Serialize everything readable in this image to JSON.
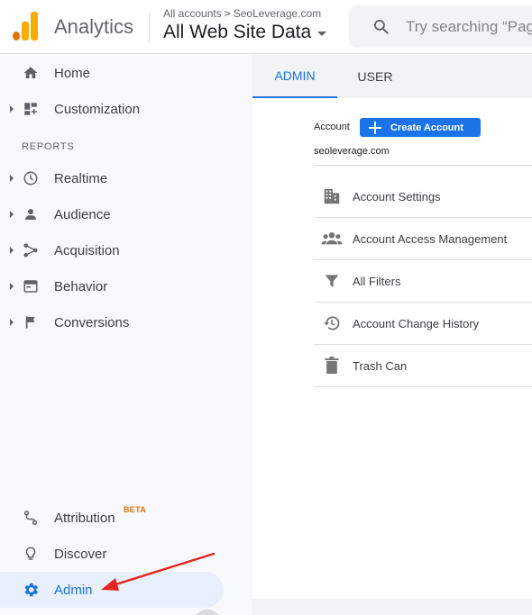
{
  "header": {
    "app_name": "Analytics",
    "breadcrumb": {
      "root": "All accounts",
      "separator": ">",
      "account": "SeoLeverage.com"
    },
    "view_name": "All Web Site Data",
    "search_placeholder": "Try searching “Pag"
  },
  "sidebar": {
    "items_top": [
      {
        "label": "Home",
        "icon": "home-icon"
      },
      {
        "label": "Customization",
        "icon": "dashboard-icon"
      }
    ],
    "section_label": "REPORTS",
    "reports": [
      {
        "label": "Realtime",
        "icon": "clock-icon"
      },
      {
        "label": "Audience",
        "icon": "person-icon"
      },
      {
        "label": "Acquisition",
        "icon": "acquisition-icon"
      },
      {
        "label": "Behavior",
        "icon": "behavior-icon"
      },
      {
        "label": "Conversions",
        "icon": "flag-icon"
      }
    ],
    "items_bottom": [
      {
        "label": "Attribution",
        "badge": "BETA",
        "icon": "attribution-icon"
      },
      {
        "label": "Discover",
        "icon": "lightbulb-icon"
      },
      {
        "label": "Admin",
        "icon": "gear-icon",
        "active": true
      }
    ]
  },
  "tabs": [
    {
      "label": "ADMIN",
      "selected": true
    },
    {
      "label": "USER",
      "selected": false
    }
  ],
  "account_column": {
    "label": "Account",
    "create_button": "Create Account",
    "selected_account": "seoleverage.com",
    "menu": [
      {
        "label": "Account Settings",
        "icon": "building-icon"
      },
      {
        "label": "Account Access Management",
        "icon": "people-icon"
      },
      {
        "label": "All Filters",
        "icon": "filter-icon"
      },
      {
        "label": "Account Change History",
        "icon": "history-icon"
      },
      {
        "label": "Trash Can",
        "icon": "trash-icon"
      }
    ]
  },
  "colors": {
    "accent": "#1a73e8",
    "logo_orange": "#f9ab00",
    "logo_dark_orange": "#e37400",
    "annotation_arrow": "#e52421",
    "beta_badge": "#e8710a"
  }
}
